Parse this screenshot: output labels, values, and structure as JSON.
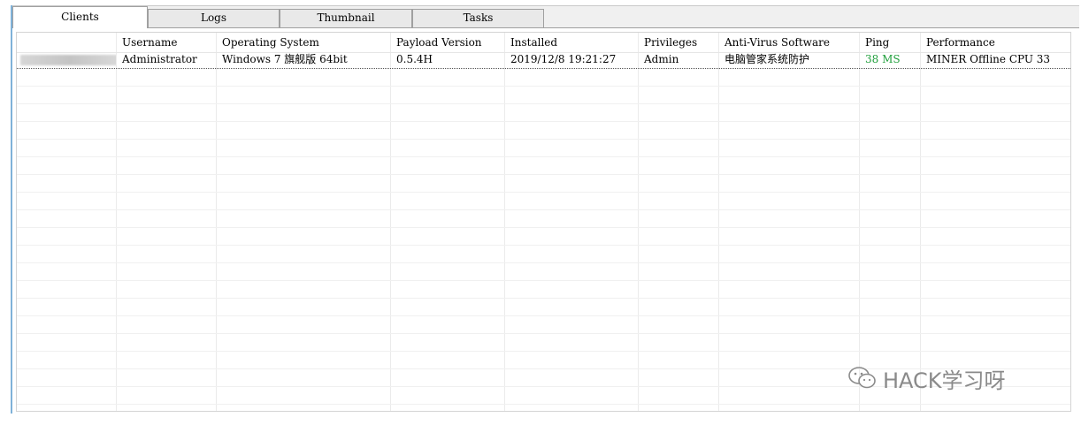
{
  "tabs": [
    {
      "label": "Clients",
      "active": true
    },
    {
      "label": "Logs",
      "active": false
    },
    {
      "label": "Thumbnail",
      "active": false
    },
    {
      "label": "Tasks",
      "active": false
    }
  ],
  "columns": [
    "",
    "Username",
    "Operating System",
    "Payload Version",
    "Installed",
    "Privileges",
    "Anti-Virus Software",
    "Ping",
    "Performance"
  ],
  "rows": [
    {
      "client": "",
      "username": "Administrator",
      "os": "Windows 7 旗舰版  64bit",
      "payload_version": "0.5.4H",
      "installed": "2019/12/8 19:21:27",
      "privileges": "Admin",
      "antivirus": "电脑管家系统防护",
      "ping": "38 MS",
      "performance": "MINER Offline    CPU 33"
    }
  ],
  "colors": {
    "ping": "#1e9e3a",
    "accent_frame": "#7fb2d9"
  },
  "watermark": {
    "text": "HACK学习呀",
    "icon": "wechat-icon"
  }
}
